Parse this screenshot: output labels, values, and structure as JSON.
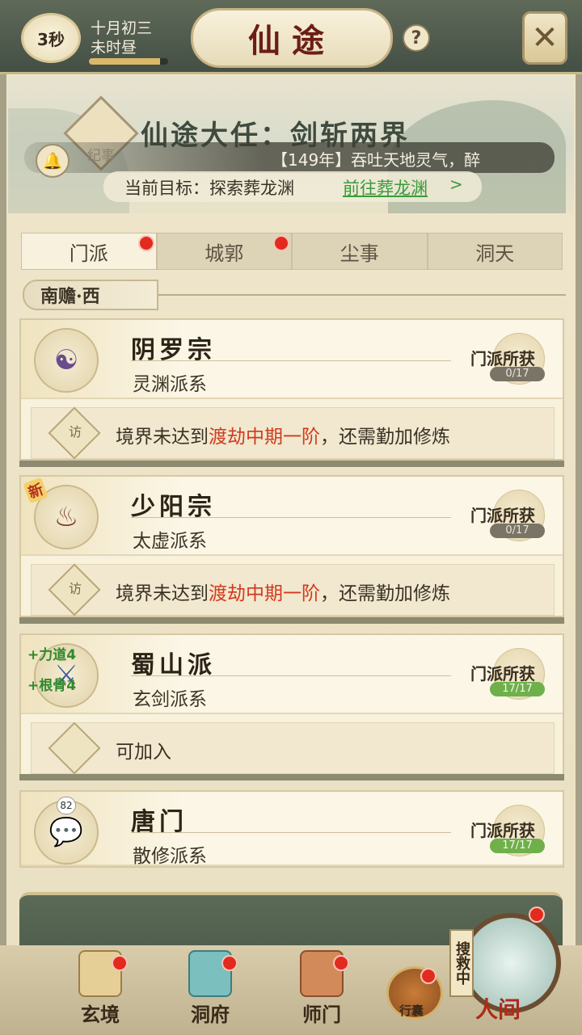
{
  "header": {
    "timer": "3秒",
    "date_line1": "十月初三",
    "date_line2": "未时昼",
    "title": "仙途",
    "help_symbol": "?",
    "close_symbol": "✕"
  },
  "quest": {
    "title": "仙途大任：剑斩两界",
    "record_label": "纪事",
    "news": "【149年】吞吐天地灵气，醉",
    "goal_label": "当前目标：探索葬龙渊",
    "goal_link": "前往葬龙渊",
    "goal_arrow": ">"
  },
  "tabs": [
    {
      "label": "门派",
      "active": true,
      "dot": true
    },
    {
      "label": "城郭",
      "active": false,
      "dot": true
    },
    {
      "label": "尘事",
      "active": false,
      "dot": false
    },
    {
      "label": "洞天",
      "active": false,
      "dot": false
    }
  ],
  "region": "南赡·西",
  "sects": [
    {
      "name": "阴罗宗",
      "branch": "灵渊派系",
      "gain_label": "门派所获",
      "gain_count": "0/17",
      "foot_pre": "境界未达到",
      "foot_hl": "渡劫中期一阶",
      "foot_post": "，还需勤加修炼",
      "foot_glyph": "访"
    },
    {
      "name": "少阳宗",
      "branch": "太虚派系",
      "badge": "新",
      "gain_label": "门派所获",
      "gain_count": "0/17",
      "foot_pre": "境界未达到",
      "foot_hl": "渡劫中期一阶",
      "foot_post": "，还需勤加修炼",
      "foot_glyph": "访"
    },
    {
      "name": "蜀山派",
      "branch": "玄剑派系",
      "attr1": "+力道4",
      "attr2": "+根骨4",
      "gain_label": "门派所获",
      "gain_count": "17/17",
      "foot_pre": "可加入",
      "foot_hl": "",
      "foot_post": ""
    },
    {
      "name": "唐门",
      "branch": "散修派系",
      "chat_count": "82",
      "gain_label": "门派所获",
      "gain_count": "17/17"
    }
  ],
  "nav": {
    "item1": "玄境",
    "item2": "洞府",
    "item3": "师门",
    "bag": "行囊",
    "search_tag": "搜救中",
    "world": "人间"
  },
  "colors": {
    "highlight_red": "#d23a1c",
    "link_green": "#3a9a3a",
    "notify_dot": "#e22b1e"
  },
  "timer_progress": 0.9
}
